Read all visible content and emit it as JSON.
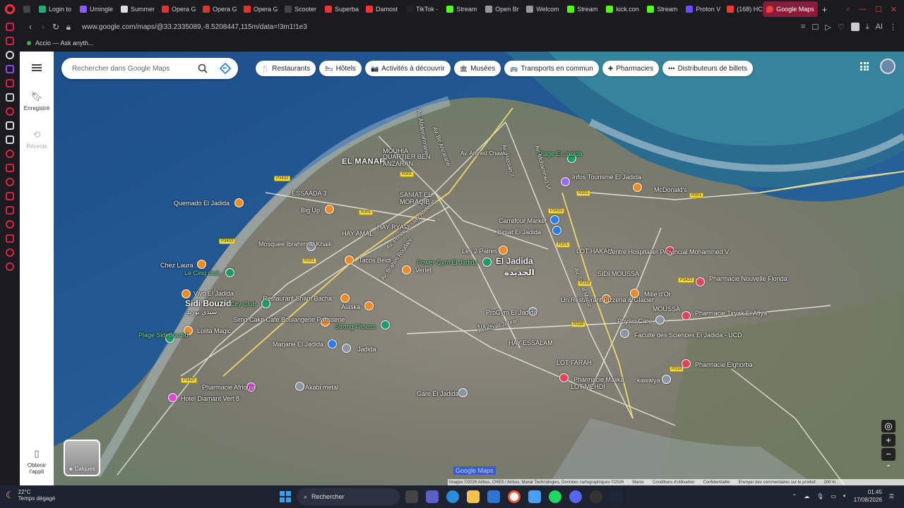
{
  "browser": {
    "tabs": [
      {
        "label": "",
        "color": "#444"
      },
      {
        "label": "Login to",
        "color": "#2a7"
      },
      {
        "label": "Umingle",
        "color": "#8b5cf6"
      },
      {
        "label": "Summer",
        "color": "#ddd"
      },
      {
        "label": "Opera G",
        "color": "#d33"
      },
      {
        "label": "Opera G",
        "color": "#d33"
      },
      {
        "label": "Opera G",
        "color": "#d33"
      },
      {
        "label": "Scooter",
        "color": "#444"
      },
      {
        "label": "Superba",
        "color": "#e33"
      },
      {
        "label": "Damost",
        "color": "#f33"
      },
      {
        "label": "TikTok -",
        "color": "#222"
      },
      {
        "label": "Stream",
        "color": "#53fc18"
      },
      {
        "label": "Open Br",
        "color": "#999"
      },
      {
        "label": "Welcom",
        "color": "#999"
      },
      {
        "label": "Stream",
        "color": "#53fc18"
      },
      {
        "label": "kick.con",
        "color": "#53fc18"
      },
      {
        "label": "Stream",
        "color": "#53fc18"
      },
      {
        "label": "Proton V",
        "color": "#6d4aff"
      },
      {
        "label": "(168) HC",
        "color": "#f33"
      }
    ],
    "active_tab": "Google Maps",
    "url": "www.google.com/maps/@33.2335089,-8.5208447,115m/data=!3m1!1e3",
    "bookmark": "Accio — Ask anyth..."
  },
  "maps": {
    "search_placeholder": "Rechercher dans Google Maps",
    "rail": {
      "saved": "Enregistré",
      "recent": "Récents",
      "get_app": "Obtenir l'appli"
    },
    "chips": [
      {
        "icon": "🍴",
        "label": "Restaurants"
      },
      {
        "icon": "🛏",
        "label": "Hôtels"
      },
      {
        "icon": "📷",
        "label": "Activités à découvrir"
      },
      {
        "icon": "🏛",
        "label": "Musées"
      },
      {
        "icon": "🚌",
        "label": "Transports en commun"
      },
      {
        "icon": "✚",
        "label": "Pharmacies"
      },
      {
        "icon": "•••",
        "label": "Distributeurs de billets"
      }
    ],
    "layers_label": "Calques",
    "selected_text": "Google Maps",
    "footer": [
      "Images ©2026 Airbus, CNES / Airbus, Maxar Technologies, Données cartographiques ©2026",
      "Maroc",
      "Conditions d'utilisation",
      "Confidentialité",
      "Envoyer des commentaires sur le produit",
      "200 m"
    ],
    "areas": [
      {
        "text": "EL MANAR"
      },
      {
        "text": "QUARTIER BEN\nANZARAN"
      },
      {
        "text": "ESSAADA 3"
      },
      {
        "text": "SANIAT EL\nMORAQIB"
      },
      {
        "text": "HAY AMAL"
      },
      {
        "text": "HAY RYAD"
      },
      {
        "text": "El Jadida"
      },
      {
        "text": "الجديدة"
      },
      {
        "text": "Sidi Bouzid"
      },
      {
        "text": "سيدي بوزيد"
      },
      {
        "text": "NAJD"
      },
      {
        "text": "HAY ESSALAM"
      },
      {
        "text": "LOT FARAH"
      },
      {
        "text": "LOT MEHDI"
      },
      {
        "text": "LOT HAKAM"
      },
      {
        "text": "SIDI MOUSSA"
      },
      {
        "text": "MOUSSA"
      },
      {
        "text": "MOUHIA"
      }
    ],
    "places": [
      {
        "text": "Quemado El Jadida",
        "color": "orange"
      },
      {
        "text": "Big Up",
        "color": "orange"
      },
      {
        "text": "Mosquee Ibrahim al Khalil",
        "color": "grey"
      },
      {
        "text": "Chez Laura",
        "color": "orange"
      },
      {
        "text": "Le Cinq club",
        "color": "green"
      },
      {
        "text": "Vivo El Jadida",
        "color": "orange"
      },
      {
        "text": "City Club",
        "color": "green"
      },
      {
        "text": "Restaurant Sham Bacha",
        "color": "orange"
      },
      {
        "text": "Lolita Magic",
        "color": "orange"
      },
      {
        "text": "Simo Cake Café Boulangerie Patisserie",
        "color": "orange"
      },
      {
        "text": "Strong Fitness",
        "color": "green"
      },
      {
        "text": "Alaska",
        "color": "orange"
      },
      {
        "text": "Tacos Beldi",
        "color": "orange"
      },
      {
        "text": "Marjane El Jadida",
        "color": "blue"
      },
      {
        "text": "Jadida",
        "color": "grey"
      },
      {
        "text": "Plage Sidi Bouzid",
        "color": "green"
      },
      {
        "text": "Pharmacie Afriquia",
        "color": "pink"
      },
      {
        "text": "Hotel Diamant Vert 8",
        "color": "pink"
      },
      {
        "text": "Akabi metal",
        "color": "grey"
      },
      {
        "text": "Gare El Jadida",
        "color": "grey"
      },
      {
        "text": "Power Gym El Jadida",
        "color": "green"
      },
      {
        "text": "Verlet",
        "color": "orange"
      },
      {
        "text": "Les 2 Paires",
        "color": "orange"
      },
      {
        "text": "Carrefour Market",
        "color": "blue"
      },
      {
        "text": "Biniat El Jadida",
        "color": "blue"
      },
      {
        "text": "Infos Tourisme El Jadida",
        "color": "purple"
      },
      {
        "text": "Plage El Jadida",
        "color": "green"
      },
      {
        "text": "McDonald's",
        "color": "orange"
      },
      {
        "text": "ProGym El Jadida",
        "color": "grey"
      },
      {
        "text": "Un Restaurant Pizzeria & Glacier",
        "color": "orange"
      },
      {
        "text": "Centre Hospitalier Provincial Mohammed V",
        "color": "red"
      },
      {
        "text": "Mille d'Or",
        "color": "orange"
      },
      {
        "text": "Physio Care",
        "color": "grey"
      },
      {
        "text": "Faculté des Sciences El Jadida - UCD",
        "color": "grey"
      },
      {
        "text": "Pharmacie Nouvelle Florida",
        "color": "red"
      },
      {
        "text": "Pharmacie Tiryak El Afiya",
        "color": "red"
      },
      {
        "text": "Pharmacie Elghorba",
        "color": "red"
      },
      {
        "text": "Pharmacie Malika",
        "color": "red"
      },
      {
        "text": "kawalya",
        "color": "grey"
      }
    ],
    "roads": [
      "Av. Abderrahmane",
      "Av. Ahmed Chawki",
      "Av. Hassan II",
      "Av. Mohammed VI",
      "Av. Khalil Jabran",
      "Av. Prince Moulay Abdellah",
      "Av. Brahim Roudani",
      "Av. Tamat Maroc",
      "Av. Bir Anzarane"
    ]
  },
  "taskbar": {
    "temp": "22°C",
    "weather": "Temps dégagé",
    "search": "Rechercher",
    "time": "01:45",
    "date": "17/08/2026"
  }
}
